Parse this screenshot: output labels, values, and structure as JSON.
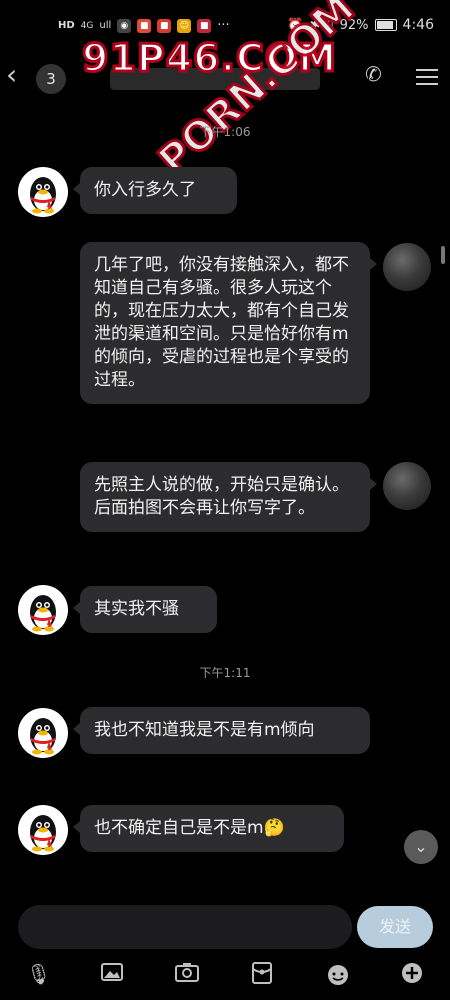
{
  "status_bar": {
    "left_indicators": [
      "HD",
      "4G",
      "ull"
    ],
    "battery": "92%",
    "time": "4:46"
  },
  "header": {
    "unread_count": "3"
  },
  "watermarks": [
    "91P46.COM",
    "PORN.COM"
  ],
  "messages": [
    {
      "type": "time",
      "text": "下午1:06"
    },
    {
      "type": "left",
      "text": "你入行多久了"
    },
    {
      "type": "right",
      "text": "几年了吧，你没有接触深入，都不知道自己有多骚。很多人玩这个的，现在压力太大，都有个自己发泄的渠道和空间。只是恰好你有m的倾向，受虐的过程也是个享受的过程。"
    },
    {
      "type": "right",
      "text": "先照主人说的做，开始只是确认。后面拍图不会再让你写字了。"
    },
    {
      "type": "left",
      "text": "其实我不骚"
    },
    {
      "type": "time",
      "text": "下午1:11"
    },
    {
      "type": "left",
      "text": "我也不知道我是不是有m倾向"
    },
    {
      "type": "left",
      "text": "也不确定自己是不是m🤔"
    }
  ],
  "input": {
    "placeholder": "",
    "send_label": "发送"
  },
  "toolbar": [
    "microphone-icon",
    "image-icon",
    "camera-icon",
    "red-packet-icon",
    "emoji-icon",
    "plus-icon"
  ],
  "colors": {
    "background": "#000000",
    "bubble": "#2c2c2e",
    "send_button": "#b7ccdc"
  }
}
